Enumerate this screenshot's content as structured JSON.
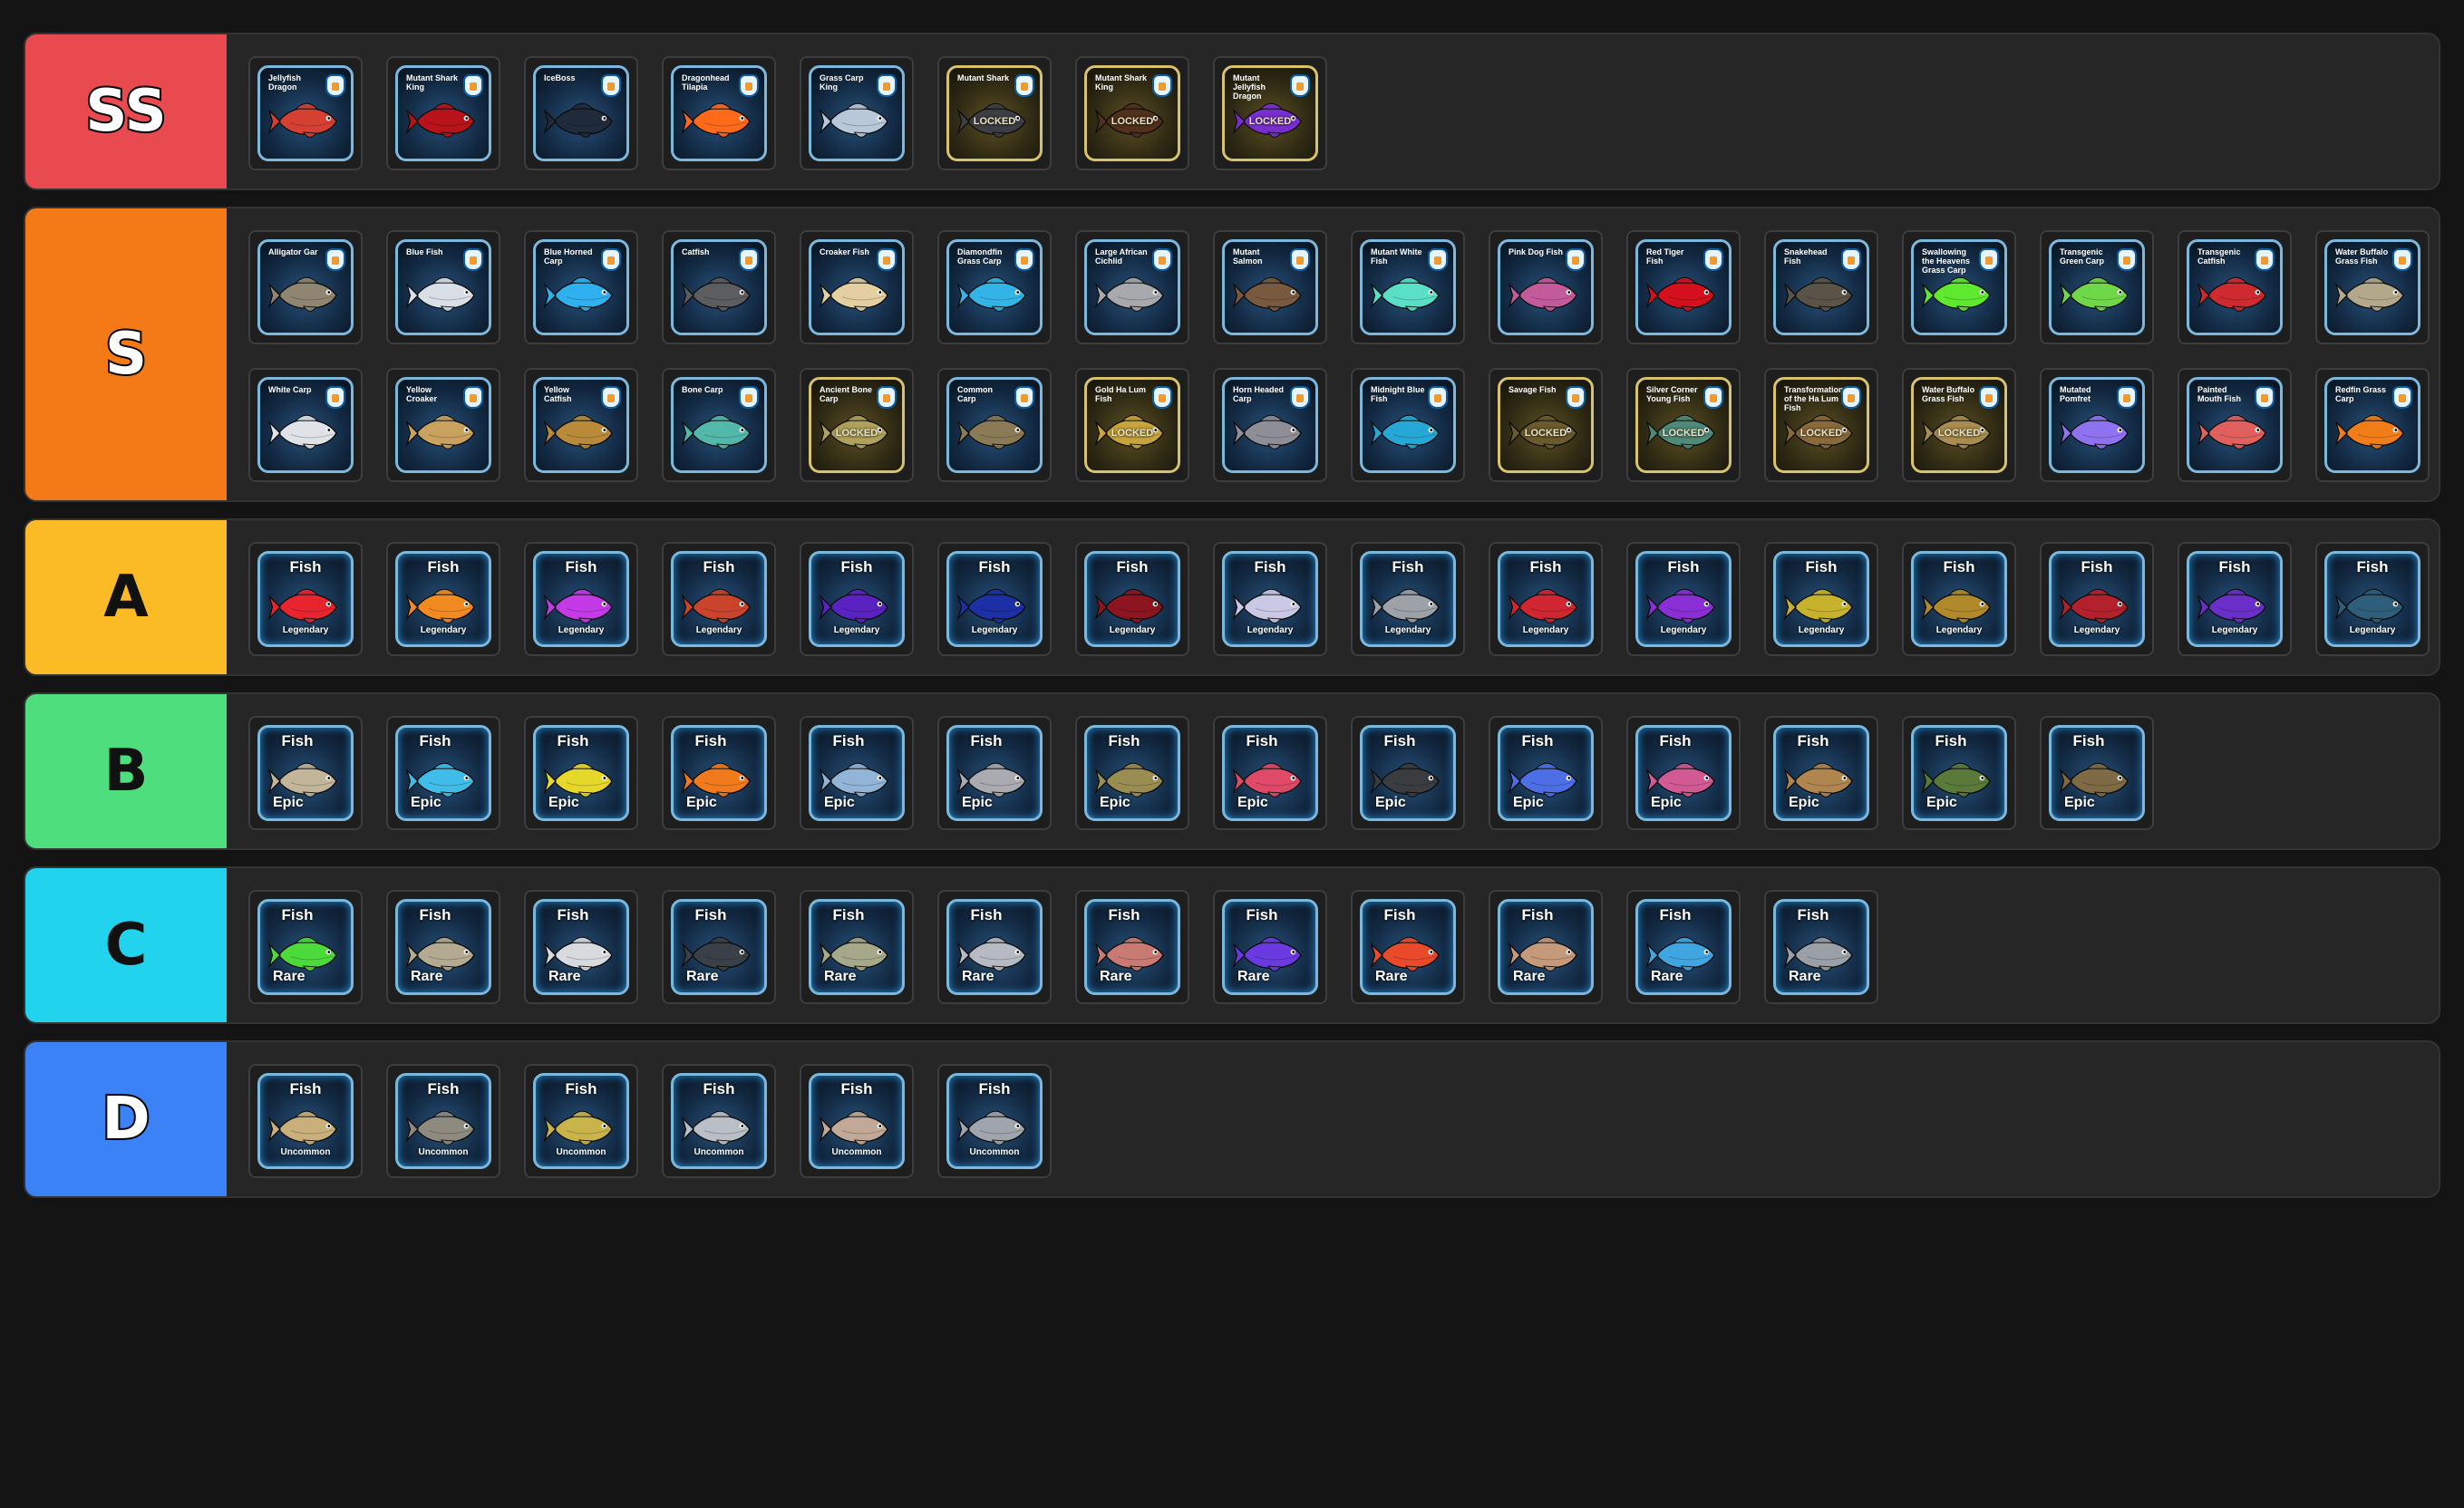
{
  "tiers": [
    {
      "label": "SS",
      "color": "#e84a4f",
      "text": "light",
      "items": [
        {
          "kind": "named",
          "name": "Jellyfish Dragon",
          "color": "#d64033"
        },
        {
          "kind": "named",
          "name": "Mutant Shark King",
          "color": "#b8131a"
        },
        {
          "kind": "named",
          "name": "IceBoss",
          "color": "#1f2b3a"
        },
        {
          "kind": "named",
          "name": "Dragonhead Tilapia",
          "color": "#ff6a1a"
        },
        {
          "kind": "named",
          "name": "Grass Carp King",
          "color": "#b8c7d9"
        },
        {
          "kind": "named",
          "name": "Mutant Shark",
          "color": "#3d3e44",
          "locked": true,
          "locked_text": "LOCKED"
        },
        {
          "kind": "named",
          "name": "Mutant Shark King",
          "color": "#52301c",
          "locked": true,
          "locked_text": "LOCKED"
        },
        {
          "kind": "named",
          "name": "Mutant Jellyfish Dragon",
          "color": "#7a2ed0",
          "locked": true,
          "locked_text": "LOCKED"
        }
      ]
    },
    {
      "label": "S",
      "color": "#f47a17",
      "text": "light",
      "items": [
        {
          "kind": "named",
          "name": "Alligator Gar",
          "color": "#8f8570"
        },
        {
          "kind": "named",
          "name": "Blue Fish",
          "color": "#d9dfe6"
        },
        {
          "kind": "named",
          "name": "Blue Horned Carp",
          "color": "#2fb1f0"
        },
        {
          "kind": "named",
          "name": "Catfish",
          "color": "#5b5d60"
        },
        {
          "kind": "named",
          "name": "Croaker Fish",
          "color": "#e3cfa0"
        },
        {
          "kind": "named",
          "name": "Diamondfin Grass Carp",
          "color": "#32b5e6"
        },
        {
          "kind": "named",
          "name": "Large African Cichlid",
          "color": "#a8a9ad"
        },
        {
          "kind": "named",
          "name": "Mutant Salmon",
          "color": "#7a5a3f"
        },
        {
          "kind": "named",
          "name": "Mutant White Fish",
          "color": "#59e0c6"
        },
        {
          "kind": "named",
          "name": "Pink Dog Fish",
          "color": "#c35a9b"
        },
        {
          "kind": "named",
          "name": "Red Tiger Fish",
          "color": "#d3101c"
        },
        {
          "kind": "named",
          "name": "Snakehead Fish",
          "color": "#5a5448"
        },
        {
          "kind": "named",
          "name": "Swallowing the Heavens Grass Carp",
          "color": "#5ee92e"
        },
        {
          "kind": "named",
          "name": "Transgenic Green Carp",
          "color": "#6fd848"
        },
        {
          "kind": "named",
          "name": "Transgenic Catfish",
          "color": "#cf2a30"
        },
        {
          "kind": "named",
          "name": "Water Buffalo Grass Fish",
          "color": "#b3a889"
        },
        {
          "kind": "named",
          "name": "White Carp",
          "color": "#dfe2e6"
        },
        {
          "kind": "named",
          "name": "Yellow Croaker",
          "color": "#c9a25f"
        },
        {
          "kind": "named",
          "name": "Yellow Catfish",
          "color": "#b98a3a"
        },
        {
          "kind": "named",
          "name": "Bone Carp",
          "color": "#52b8aa"
        },
        {
          "kind": "named",
          "name": "Ancient Bone Carp",
          "color": "#b0a15a",
          "locked": true,
          "locked_text": "LOCKED"
        },
        {
          "kind": "named",
          "name": "Common Carp",
          "color": "#8a7a55"
        },
        {
          "kind": "named",
          "name": "Gold Ha Lum Fish",
          "color": "#c8a43c",
          "locked": true,
          "locked_text": "LOCKED"
        },
        {
          "kind": "named",
          "name": "Horn Headed Carp",
          "color": "#8d8e96"
        },
        {
          "kind": "named",
          "name": "Midnight Blue Fish",
          "color": "#25a8d6"
        },
        {
          "kind": "named",
          "name": "Savage Fish",
          "color": "#6b5a2b",
          "locked": true,
          "locked_text": "LOCKED"
        },
        {
          "kind": "named",
          "name": "Silver Corner Young Fish",
          "color": "#4f8a78",
          "locked": true,
          "locked_text": "LOCKED"
        },
        {
          "kind": "named",
          "name": "Transformation of the Ha Lum Fish",
          "color": "#8a6a3b",
          "locked": true,
          "locked_text": "LOCKED"
        },
        {
          "kind": "named",
          "name": "Water Buffalo Grass Fish",
          "color": "#a88d4e",
          "locked": true,
          "locked_text": "LOCKED"
        },
        {
          "kind": "named",
          "name": "Mutated Pomfret",
          "color": "#8f72f0"
        },
        {
          "kind": "named",
          "name": "Painted Mouth Fish",
          "color": "#e0605d"
        },
        {
          "kind": "named",
          "name": "Redfin Grass Carp",
          "color": "#f07d18"
        }
      ]
    },
    {
      "label": "A",
      "color": "#fbbb25",
      "text": "dark",
      "items": [
        {
          "kind": "rarity",
          "name": "Fish",
          "rarity": "Legendary",
          "color": "#e8242e"
        },
        {
          "kind": "rarity",
          "name": "Fish",
          "rarity": "Legendary",
          "color": "#f28a22"
        },
        {
          "kind": "rarity",
          "name": "Fish",
          "rarity": "Legendary",
          "color": "#c33ae6"
        },
        {
          "kind": "rarity",
          "name": "Fish",
          "rarity": "Legendary",
          "color": "#c9442a"
        },
        {
          "kind": "rarity",
          "name": "Fish",
          "rarity": "Legendary",
          "color": "#5b22c2"
        },
        {
          "kind": "rarity",
          "name": "Fish",
          "rarity": "Legendary",
          "color": "#1c2fa5"
        },
        {
          "kind": "rarity",
          "name": "Fish",
          "rarity": "Legendary",
          "color": "#8d1520"
        },
        {
          "kind": "rarity",
          "name": "Fish",
          "rarity": "Legendary",
          "color": "#c9c9e6"
        },
        {
          "kind": "rarity",
          "name": "Fish",
          "rarity": "Legendary",
          "color": "#9da1a8"
        },
        {
          "kind": "rarity",
          "name": "Fish",
          "rarity": "Legendary",
          "color": "#d02631"
        },
        {
          "kind": "rarity",
          "name": "Fish",
          "rarity": "Legendary",
          "color": "#8a2ed6"
        },
        {
          "kind": "rarity",
          "name": "Fish",
          "rarity": "Legendary",
          "color": "#c7b22c"
        },
        {
          "kind": "rarity",
          "name": "Fish",
          "rarity": "Legendary",
          "color": "#b08a2a"
        },
        {
          "kind": "rarity",
          "name": "Fish",
          "rarity": "Legendary",
          "color": "#b3212c"
        },
        {
          "kind": "rarity",
          "name": "Fish",
          "rarity": "Legendary",
          "color": "#6b2fc9"
        },
        {
          "kind": "rarity",
          "name": "Fish",
          "rarity": "Legendary",
          "color": "#2e5f7a"
        }
      ]
    },
    {
      "label": "B",
      "color": "#4fde7e",
      "text": "dark",
      "items": [
        {
          "kind": "rarity",
          "name": "Fish",
          "rarity": "Epic",
          "color": "#c2b59a"
        },
        {
          "kind": "rarity",
          "name": "Fish",
          "rarity": "Epic",
          "color": "#3fbde8"
        },
        {
          "kind": "rarity",
          "name": "Fish",
          "rarity": "Epic",
          "color": "#e6d82a"
        },
        {
          "kind": "rarity",
          "name": "Fish",
          "rarity": "Epic",
          "color": "#f07a1c"
        },
        {
          "kind": "rarity",
          "name": "Fish",
          "rarity": "Epic",
          "color": "#92b4d6"
        },
        {
          "kind": "rarity",
          "name": "Fish",
          "rarity": "Epic",
          "color": "#a9abb0"
        },
        {
          "kind": "rarity",
          "name": "Fish",
          "rarity": "Epic",
          "color": "#9a8d52"
        },
        {
          "kind": "rarity",
          "name": "Fish",
          "rarity": "Epic",
          "color": "#e04a69"
        },
        {
          "kind": "rarity",
          "name": "Fish",
          "rarity": "Epic",
          "color": "#3a3c40"
        },
        {
          "kind": "rarity",
          "name": "Fish",
          "rarity": "Epic",
          "color": "#4d6fe6"
        },
        {
          "kind": "rarity",
          "name": "Fish",
          "rarity": "Epic",
          "color": "#d15a94"
        },
        {
          "kind": "rarity",
          "name": "Fish",
          "rarity": "Epic",
          "color": "#b0854e"
        },
        {
          "kind": "rarity",
          "name": "Fish",
          "rarity": "Epic",
          "color": "#5a7a3a"
        },
        {
          "kind": "rarity",
          "name": "Fish",
          "rarity": "Epic",
          "color": "#7e6a44"
        }
      ]
    },
    {
      "label": "C",
      "color": "#22d3ee",
      "text": "dark",
      "items": [
        {
          "kind": "rarity",
          "name": "Fish",
          "rarity": "Rare",
          "color": "#4cd93a"
        },
        {
          "kind": "rarity",
          "name": "Fish",
          "rarity": "Rare",
          "color": "#b4aa92"
        },
        {
          "kind": "rarity",
          "name": "Fish",
          "rarity": "Rare",
          "color": "#d7dbe0"
        },
        {
          "kind": "rarity",
          "name": "Fish",
          "rarity": "Rare",
          "color": "#3a4048"
        },
        {
          "kind": "rarity",
          "name": "Fish",
          "rarity": "Rare",
          "color": "#a6a88a"
        },
        {
          "kind": "rarity",
          "name": "Fish",
          "rarity": "Rare",
          "color": "#b6bac2"
        },
        {
          "kind": "rarity",
          "name": "Fish",
          "rarity": "Rare",
          "color": "#c97a72"
        },
        {
          "kind": "rarity",
          "name": "Fish",
          "rarity": "Rare",
          "color": "#6a3ae0"
        },
        {
          "kind": "rarity",
          "name": "Fish",
          "rarity": "Rare",
          "color": "#e84a2a"
        },
        {
          "kind": "rarity",
          "name": "Fish",
          "rarity": "Rare",
          "color": "#c49a7a"
        },
        {
          "kind": "rarity",
          "name": "Fish",
          "rarity": "Rare",
          "color": "#3fa6e2"
        },
        {
          "kind": "rarity",
          "name": "Fish",
          "rarity": "Rare",
          "color": "#9aa0a8"
        }
      ]
    },
    {
      "label": "D",
      "color": "#3b82f6",
      "text": "light",
      "items": [
        {
          "kind": "rarity",
          "name": "Fish",
          "rarity": "Uncommon",
          "color": "#c9b07a"
        },
        {
          "kind": "rarity",
          "name": "Fish",
          "rarity": "Uncommon",
          "color": "#8e8a80"
        },
        {
          "kind": "rarity",
          "name": "Fish",
          "rarity": "Uncommon",
          "color": "#c8b44a"
        },
        {
          "kind": "rarity",
          "name": "Fish",
          "rarity": "Uncommon",
          "color": "#b9bfc6"
        },
        {
          "kind": "rarity",
          "name": "Fish",
          "rarity": "Uncommon",
          "color": "#c2a896"
        },
        {
          "kind": "rarity",
          "name": "Fish",
          "rarity": "Uncommon",
          "color": "#9fa5ad"
        }
      ]
    }
  ]
}
